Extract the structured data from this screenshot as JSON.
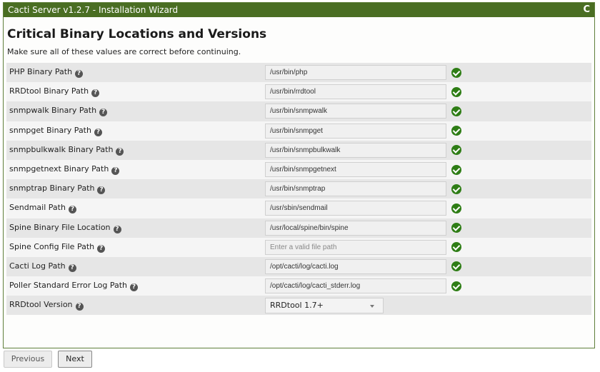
{
  "window": {
    "title": "Cacti Server v1.2.7 - Installation Wizard",
    "refresh_glyph": "C"
  },
  "page": {
    "heading": "Critical Binary Locations and Versions",
    "subheading": "Make sure all of these values are correct before continuing."
  },
  "fields": [
    {
      "label": "PHP Binary Path",
      "value": "/usr/bin/php",
      "placeholder": ""
    },
    {
      "label": "RRDtool Binary Path",
      "value": "/usr/bin/rrdtool",
      "placeholder": ""
    },
    {
      "label": "snmpwalk Binary Path",
      "value": "/usr/bin/snmpwalk",
      "placeholder": ""
    },
    {
      "label": "snmpget Binary Path",
      "value": "/usr/bin/snmpget",
      "placeholder": ""
    },
    {
      "label": "snmpbulkwalk Binary Path",
      "value": "/usr/bin/snmpbulkwalk",
      "placeholder": ""
    },
    {
      "label": "snmpgetnext Binary Path",
      "value": "/usr/bin/snmpgetnext",
      "placeholder": ""
    },
    {
      "label": "snmptrap Binary Path",
      "value": "/usr/bin/snmptrap",
      "placeholder": ""
    },
    {
      "label": "Sendmail Path",
      "value": "/usr/sbin/sendmail",
      "placeholder": ""
    },
    {
      "label": "Spine Binary File Location",
      "value": "/usr/local/spine/bin/spine",
      "placeholder": ""
    },
    {
      "label": "Spine Config File Path",
      "value": "",
      "placeholder": "Enter a valid file path"
    },
    {
      "label": "Cacti Log Path",
      "value": "/opt/cacti/log/cacti.log",
      "placeholder": ""
    },
    {
      "label": "Poller Standard Error Log Path",
      "value": "/opt/cacti/log/cacti_stderr.log",
      "placeholder": ""
    }
  ],
  "rrdtool_version": {
    "label": "RRDtool Version",
    "selected": "RRDtool 1.7+"
  },
  "buttons": {
    "previous": "Previous",
    "next": "Next"
  },
  "icons": {
    "help": "question-circle-icon",
    "status": "check-circle-icon",
    "refresh": "refresh-icon"
  },
  "colors": {
    "titlebar": "#4a6e23",
    "check": "#2e7d15"
  }
}
